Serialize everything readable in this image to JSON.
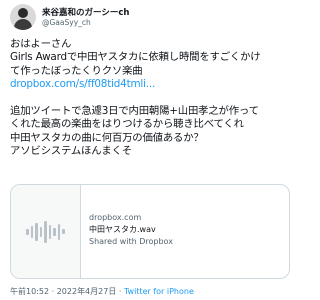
{
  "author": {
    "display_name": "来谷嘉和のガーシーch",
    "handle": "@GaaSyy_ch"
  },
  "tweet": {
    "lines_1": [
      "おはよーさん",
      "Girls Awardで中田ヤスタカに依頼し時間をすごくかけ",
      "て作ったぼったくりクソ楽曲"
    ],
    "link": "dropbox.com/s/ff08tid4tmli...",
    "lines_2": [
      "追加ツイートで急遽3日で内田朝陽+山田孝之が作って",
      "くれた最高の楽曲をはりつけるから聴き比べてくれ",
      "中田ヤスタカの曲に何百万の価値あるか？",
      "アソビシステムほんまくそ"
    ]
  },
  "card": {
    "domain": "dropbox.com",
    "title": "中田ヤスタカ.wav",
    "subtitle": "Shared with Dropbox",
    "icon": "audio-waveform-icon"
  },
  "meta": {
    "time": "午前10:52",
    "separator": "·",
    "date": "2022年4月27日",
    "source": "Twitter for iPhone"
  }
}
